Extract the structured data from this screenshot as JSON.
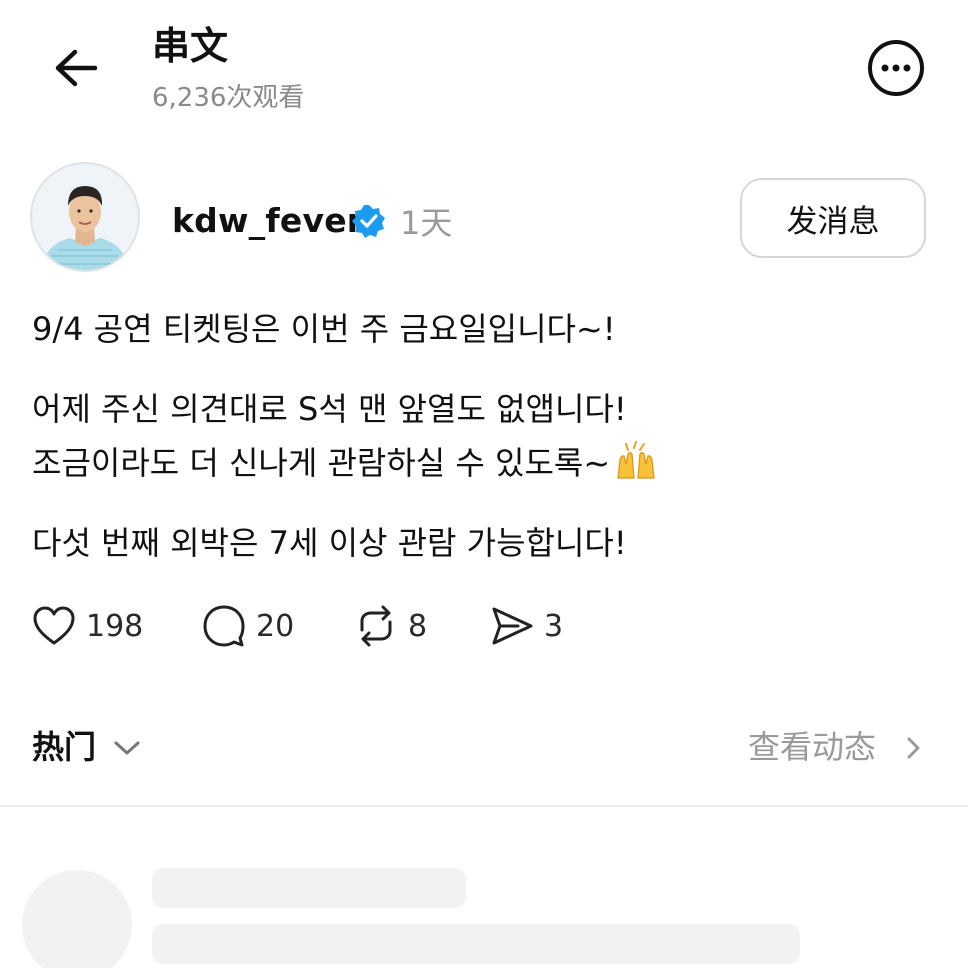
{
  "header": {
    "title": "串文",
    "views": "6,236次观看"
  },
  "author": {
    "username": "kdw_fever",
    "verified": true,
    "time": "1天",
    "message_button": "发消息"
  },
  "post": {
    "lines": [
      "9/4 공연 티켓팅은 이번 주 금요일입니다~!",
      "어제 주신 의견대로 S석 맨 앞열도 없앱니다!",
      "조금이라도 더 신나게 관람하실 수 있도록~",
      "다섯 번째 외박은 7세 이상 관람 가능합니다!"
    ],
    "emoji": "raising-hands-emoji"
  },
  "actions": {
    "likes": "198",
    "comments": "20",
    "reposts": "8",
    "shares": "3"
  },
  "sort": {
    "label": "热门",
    "view_activity": "查看动态"
  },
  "colors": {
    "verified_badge": "#1d9bf0",
    "muted_text": "#9a9a9a",
    "skeleton": "#f2f2f2"
  }
}
